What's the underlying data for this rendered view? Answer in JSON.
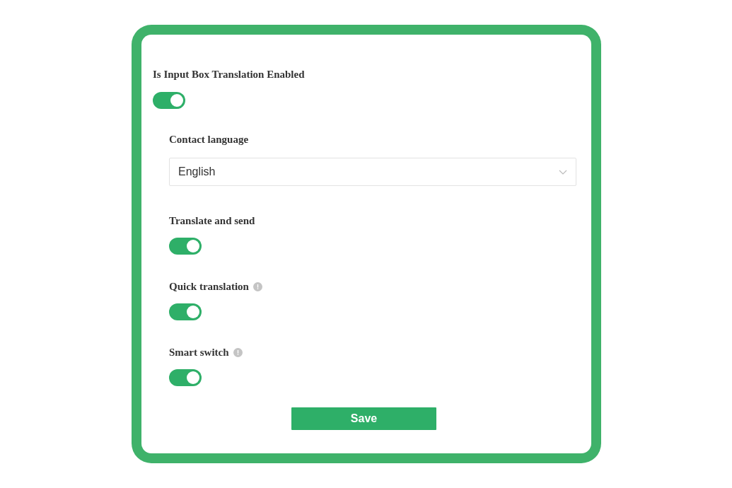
{
  "main_toggle": {
    "label": "Is Input Box Translation Enabled",
    "on": true
  },
  "language": {
    "label": "Contact language",
    "value": "English"
  },
  "settings": [
    {
      "label": "Translate and send",
      "info": false,
      "on": true
    },
    {
      "label": "Quick translation",
      "info": true,
      "on": true
    },
    {
      "label": "Smart switch",
      "info": true,
      "on": true
    }
  ],
  "save_button": "Save"
}
